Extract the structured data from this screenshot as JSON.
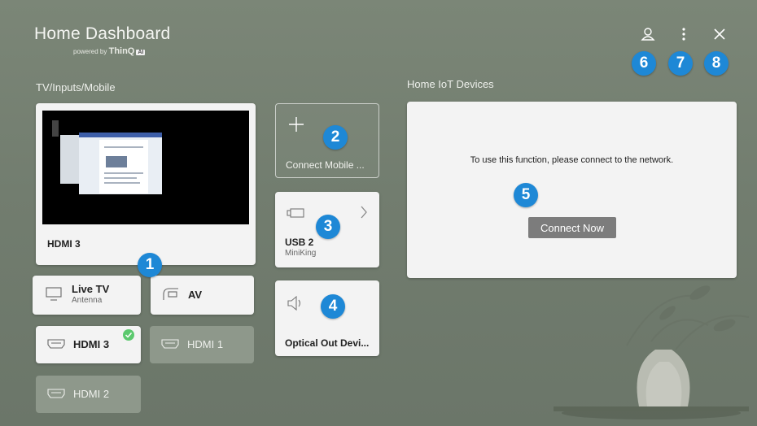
{
  "header": {
    "title": "Home Dashboard",
    "powered_by": "powered by",
    "brand": "ThinQ",
    "ai": "AI"
  },
  "sections": {
    "tv_inputs": "TV/Inputs/Mobile",
    "iot": "Home IoT Devices"
  },
  "tv_card": {
    "label": "HDMI 3"
  },
  "connect_mobile": {
    "label": "Connect Mobile ..."
  },
  "usb": {
    "title": "USB 2",
    "subtitle": "MiniKing"
  },
  "optical": {
    "label": "Optical Out Devi..."
  },
  "inputs": {
    "live_tv": {
      "label": "Live TV",
      "sub": "Antenna"
    },
    "av": {
      "label": "AV"
    },
    "hdmi3": {
      "label": "HDMI 3"
    },
    "hdmi1": {
      "label": "HDMI 1"
    },
    "hdmi2": {
      "label": "HDMI 2"
    }
  },
  "iot": {
    "message": "To use this function, please connect to the network.",
    "button": "Connect Now"
  },
  "badges": {
    "b1": "1",
    "b2": "2",
    "b3": "3",
    "b4": "4",
    "b5": "5",
    "b6": "6",
    "b7": "7",
    "b8": "8"
  },
  "icons": [
    "account-icon",
    "more-vertical-icon",
    "close-icon",
    "plus-icon",
    "usb-icon",
    "speaker-icon",
    "tv-icon",
    "av-icon",
    "hdmi-icon",
    "check-icon",
    "chevron-right-icon"
  ],
  "colors": {
    "badge": "#1e88d6",
    "check": "#5cc96e",
    "background": "#747f71"
  }
}
